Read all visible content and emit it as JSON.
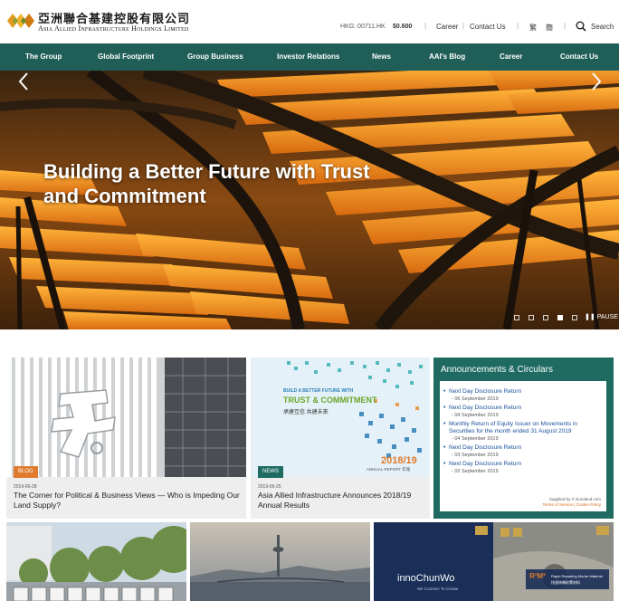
{
  "header": {
    "company_zh": "亞洲聯合基建控股有限公司",
    "company_en": "Asia Allied Infrastructure Holdings Limited",
    "ticker": "HKG: 00711.HK",
    "price": "$0.600",
    "links": {
      "career": "Career",
      "contact": "Contact Us",
      "lang_tc": "繁",
      "lang_sc": "簡",
      "search": "Search"
    }
  },
  "nav": [
    "The Group",
    "Global Footprint",
    "Group Business",
    "Investor Relations",
    "News",
    "AAI's Blog",
    "Career",
    "Contact Us"
  ],
  "hero": {
    "title": "Building a Better Future with Trust and Commitment",
    "pause": "PAUSE",
    "slide_count": 5,
    "active_slide": 4
  },
  "cards": [
    {
      "tag": "BLOG",
      "tag_color": "#e07b2e",
      "date": "2019-06-28",
      "title": "The Corner for Political & Business Views — Who is Impeding Our Land Supply?"
    },
    {
      "tag": "NEWS",
      "tag_color": "#1f6b62",
      "date": "2019-06-25",
      "title": "Asia Allied Infrastructure Announces 2018/19 Annual Results",
      "report": {
        "line1": "BUILD A BETTER FUTURE WITH",
        "line2": "TRUST & COMMITMENT",
        "zh": "承建互信 共建未來",
        "year": "2018/19",
        "label": "ANNUAL REPORT 年報"
      }
    }
  ],
  "announcements": {
    "title": "Announcements & Circulars",
    "items": [
      {
        "text": "Next Day Disclosure Return",
        "date": "- 06 September 2019"
      },
      {
        "text": "Next Day Disclosure Return",
        "date": "- 04 September 2019"
      },
      {
        "text": "Monthly Return of Equity Issuer on Movements in Securities for the month ended 31 August 2019",
        "date": "- 04 September 2019"
      },
      {
        "text": "Next Day Disclosure Return",
        "date": "- 03 September 2019"
      },
      {
        "text": "Next Day Disclosure Return",
        "date": "- 02 September 2019"
      }
    ],
    "supplied": "Supplied by © Euroland.com",
    "policy": "Terms of Service | Cookie Policy"
  },
  "bottom_tiles": {
    "chunwo_logo": "innoChunWo",
    "chunwo_sub": "We Connect To Create",
    "r2m2": "R²M²",
    "r2m2_caption": "Rapid Repairing Mortar Material",
    "r2m2_zh": "快速修補砂漿材料"
  }
}
